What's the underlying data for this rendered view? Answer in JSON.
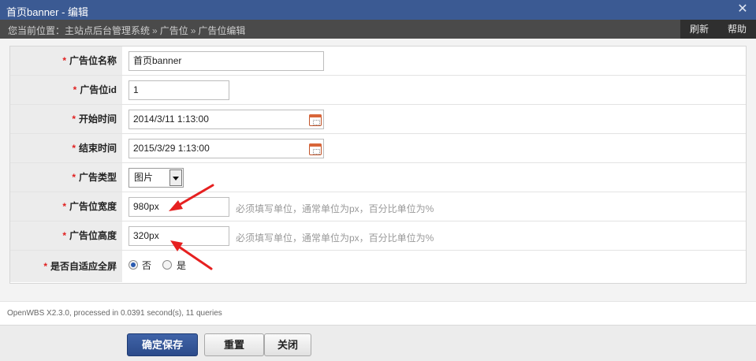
{
  "window": {
    "title": "首页banner - 编辑",
    "close_glyph": "✕"
  },
  "location": {
    "prefix": "您当前位置：",
    "crumbs": [
      "主站点后台管理系统",
      "广告位",
      "广告位编辑"
    ],
    "separator": "»",
    "tools": {
      "refresh": "刷新",
      "help": "帮助"
    }
  },
  "form": {
    "required_mark": "*",
    "name": {
      "label": "广告位名称",
      "value": "首页banner"
    },
    "id": {
      "label": "广告位id",
      "value": "1"
    },
    "start": {
      "label": "开始时间",
      "value": "2014/3/11 1:13:00"
    },
    "end": {
      "label": "结束时间",
      "value": "2015/3/29 1:13:00"
    },
    "type": {
      "label": "广告类型",
      "value": "图片"
    },
    "width": {
      "label": "广告位宽度",
      "value": "980px",
      "hint": "必须填写单位，通常单位为px，百分比单位为%"
    },
    "height": {
      "label": "广告位高度",
      "value": "320px",
      "hint": "必须填写单位，通常单位为px，百分比单位为%"
    },
    "fullscreen": {
      "label": "是否自适应全屏",
      "option_no": "否",
      "option_yes": "是",
      "selected": "否"
    }
  },
  "footer": {
    "info": "OpenWBS X2.3.0, processed in 0.0391 second(s), 11 queries"
  },
  "actions": {
    "save": "确定保存",
    "reset": "重置",
    "close": "关闭"
  },
  "colors": {
    "titlebar": "#3b5a93",
    "locbar": "#4a4a4a",
    "arrow": "#e62020",
    "required": "#e02020"
  }
}
